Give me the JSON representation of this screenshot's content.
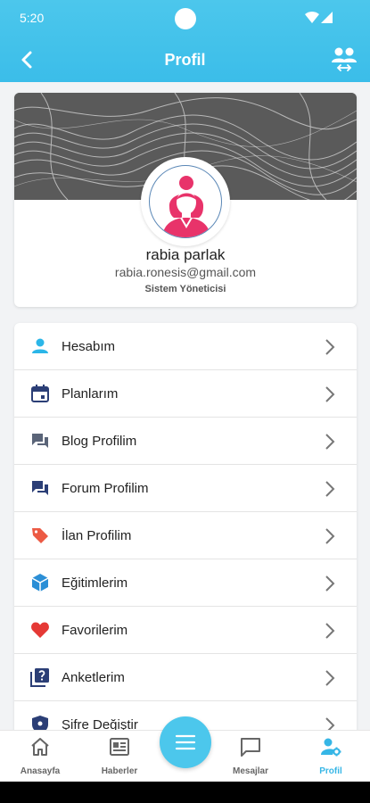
{
  "status_bar": {
    "time": "5:20"
  },
  "header": {
    "title": "Profil"
  },
  "profile": {
    "name": "rabia parlak",
    "email": "rabia.ronesis@gmail.com",
    "role": "Sistem Yöneticisi"
  },
  "menu": {
    "items": [
      {
        "label": "Hesabım",
        "icon": "person-icon",
        "color": "#2bb6e8"
      },
      {
        "label": "Planlarım",
        "icon": "calendar-icon",
        "color": "#2b3e76"
      },
      {
        "label": "Blog Profilim",
        "icon": "chat-bubbles-icon",
        "color": "#5a6478"
      },
      {
        "label": "Forum Profilim",
        "icon": "forum-icon",
        "color": "#2b3e76"
      },
      {
        "label": "İlan Profilim",
        "icon": "tag-icon",
        "color": "#ec5a44"
      },
      {
        "label": "Eğitimlerim",
        "icon": "box-icon",
        "color": "#2b8fd6"
      },
      {
        "label": "Favorilerim",
        "icon": "heart-icon",
        "color": "#e53935"
      },
      {
        "label": "Anketlerim",
        "icon": "quiz-icon",
        "color": "#2b3e76"
      },
      {
        "label": "Şifre Değiştir",
        "icon": "lock-icon",
        "color": "#2b3e76"
      }
    ]
  },
  "bottom_nav": {
    "items": [
      {
        "label": "Anasayfa",
        "icon": "home-icon"
      },
      {
        "label": "Haberler",
        "icon": "news-icon"
      },
      {
        "label": "Mesajlar",
        "icon": "message-icon"
      },
      {
        "label": "Profil",
        "icon": "profile-settings-icon",
        "active": true
      }
    ]
  },
  "colors": {
    "accent": "#4cc7ec",
    "active_label": "#36b6e6"
  }
}
